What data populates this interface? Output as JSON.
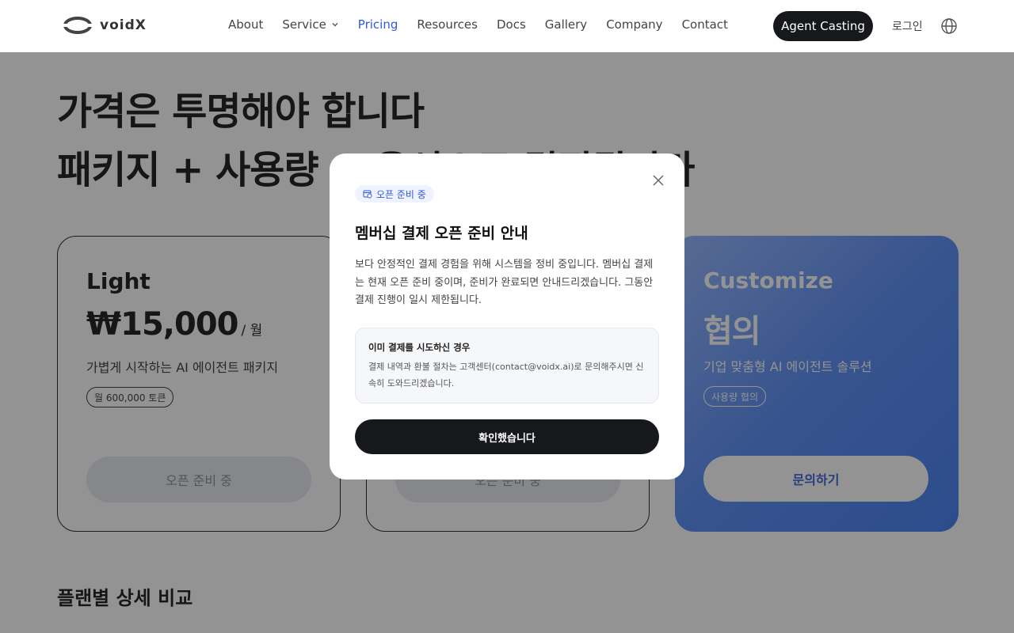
{
  "header": {
    "logo_text": "voidX",
    "nav": {
      "about": "About",
      "service": "Service",
      "pricing": "Pricing",
      "resources": "Resources",
      "docs": "Docs",
      "gallery": "Gallery",
      "company": "Company",
      "contact": "Contact"
    },
    "cta_label": "Agent Casting",
    "login_label": "로그인",
    "icons": {
      "language": "globe-icon",
      "dropdown": "chevron-down-icon"
    }
  },
  "hero": {
    "line1": "가격은 투명해야 합니다",
    "line2": "패키지 + 사용량 + 옵션으로 결정됩니다"
  },
  "plans": [
    {
      "name": "Light",
      "price": "₩15,000",
      "unit": "/ 월",
      "desc": "가볍게 시작하는 AI 에이전트 패키지",
      "chip": "월 600,000 토큰",
      "button": "오픈 준비 중"
    },
    {
      "name": "",
      "price": "",
      "unit": "",
      "desc": "",
      "chip": "",
      "button": "오픈 준비 중"
    },
    {
      "name": "Customize",
      "price": "협의",
      "unit": "",
      "desc": "기업 맞춤형 AI 에이전트 솔루션",
      "chip": "사용량 협의",
      "button": "문의하기"
    }
  ],
  "comparison_title": "플랜별 상세 비교",
  "modal": {
    "badge": "오픈 준비 중",
    "title": "멤버십 결제 오픈 준비 안내",
    "body": "보다 안정적인 결제 경험을 위해 시스템을 정비 중입니다. 멤버십 결제는 현재 오픈 준비 중이며, 준비가 완료되면 안내드리겠습니다. 그동안 결제 진행이 일시 제한됩니다.",
    "info_title": "이미 결제를 시도하신 경우",
    "info_body": "결제 내역과 환불 절차는 고객센터(contact@voidx.ai)로 문의해주시면 신속히 도와드리겠습니다.",
    "confirm_label": "확인했습니다",
    "icons": {
      "close": "close-icon",
      "badge": "calendar-clock-icon"
    }
  },
  "colors": {
    "accent": "#2f5ad8",
    "dark": "#16181b",
    "overlay": "rgba(30,30,30,0.48)"
  }
}
